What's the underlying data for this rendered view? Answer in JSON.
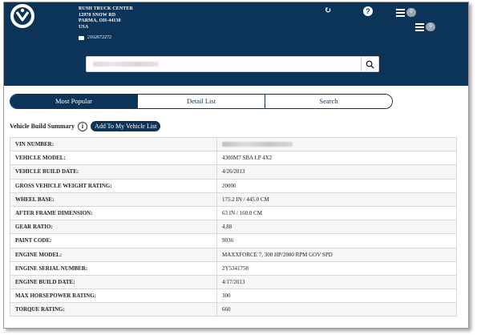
{
  "header": {
    "dealer": {
      "name": "RUSH TRUCK CENTER",
      "street": "12970 SNOW RD",
      "city": "PARMA, OH-44130",
      "country": "USA",
      "phone": "2162672272"
    },
    "badges": {
      "list1_count": "0",
      "list2_count": "0"
    },
    "icons": {
      "refresh": "refresh-icon",
      "help": "help-icon",
      "list": "list-icon",
      "phone": "phone-icon"
    },
    "help_glyph": "?"
  },
  "search": {
    "placeholder": ""
  },
  "tabs": [
    {
      "label": "Most Popular",
      "active": true
    },
    {
      "label": "Detail List",
      "active": false
    },
    {
      "label": "Search",
      "active": false
    }
  ],
  "summary": {
    "title": "Vehicle Build Summary",
    "info_glyph": "i",
    "add_button": "Add To My Vehicle List"
  },
  "rows": [
    {
      "label": "VIN NUMBER:",
      "value": ""
    },
    {
      "label": "VEHICLE MODEL:",
      "value": "4300M7 SBA LP 4X2"
    },
    {
      "label": "VEHICLE BUILD DATE:",
      "value": "4/26/2013"
    },
    {
      "label": "GROSS VEHICLE WEIGHT RATING:",
      "value": "20000"
    },
    {
      "label": "WHEEL BASE:",
      "value": "175.2 IN / 445.0 CM"
    },
    {
      "label": "AFTER FRAME DIMENSION:",
      "value": "63 IN / 160.0 CM"
    },
    {
      "label": "GEAR RATIO:",
      "value": "4.88"
    },
    {
      "label": "PAINT CODE:",
      "value": "9036"
    },
    {
      "label": "ENGINE MODEL:",
      "value": "MAXXFORCE 7, 300 HP/2800 RPM GOV SPD"
    },
    {
      "label": "ENGINE SERIAL NUMBER:",
      "value": "2Y5341758"
    },
    {
      "label": "ENGINE BUILD DATE:",
      "value": "4/17/2013"
    },
    {
      "label": "MAX HORSEPOWER RATING:",
      "value": "300"
    },
    {
      "label": "TORQUE RATING:",
      "value": "660"
    }
  ],
  "colors": {
    "brand": "#0c3459",
    "badge": "#9aa4ae"
  }
}
